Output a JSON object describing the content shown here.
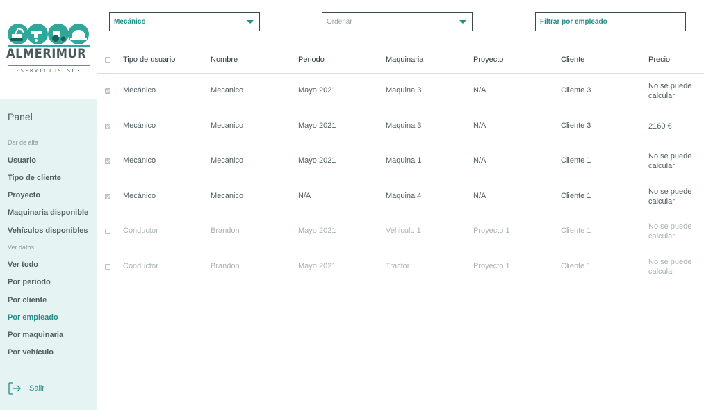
{
  "brand": {
    "name": "ALMERIMUR",
    "subtitle": "·SERVICIOS SL·"
  },
  "colors": {
    "accent": "#1f8f87",
    "sidebar_bg": "#e5f3f2",
    "logo_teal": "#2fa79a"
  },
  "sidebar": {
    "panel_title": "Panel",
    "sections": [
      {
        "label": "Dar de alta",
        "items": [
          "Usuario",
          "Tipo de cliente",
          "Proyecto",
          "Maquinaria disponible",
          "Vehículos disponibles"
        ]
      },
      {
        "label": "Ver datos",
        "items": [
          "Ver todo",
          "Por periodo",
          "Por cliente",
          "Por empleado",
          "Por maquinaria",
          "Por vehículo"
        ]
      }
    ],
    "active_item": "Por empleado",
    "logout": {
      "label": "Salir",
      "icon": "logout-icon"
    }
  },
  "filters": {
    "role_select": {
      "value": "Mecánico"
    },
    "order_select": {
      "placeholder": "Ordenar"
    },
    "employee_filter": {
      "value": "Filtrar por empleado"
    }
  },
  "table": {
    "headers": [
      "Tipo de usuario",
      "Nombre",
      "Periodo",
      "Maquinaria",
      "Proyecto",
      "Cliente",
      "Precio"
    ],
    "rows": [
      {
        "checked": true,
        "tipo": "Mecánico",
        "nombre": "Mecanico",
        "periodo": "Mayo 2021",
        "maquinaria": "Maquina 3",
        "proyecto": "N/A",
        "cliente": "Cliente 3",
        "precio": "No se puede calcular"
      },
      {
        "checked": true,
        "tipo": "Mecánico",
        "nombre": "Mecanico",
        "periodo": "Mayo 2021",
        "maquinaria": "Maquina 3",
        "proyecto": "N/A",
        "cliente": "Cliente 3",
        "precio": "2160 €"
      },
      {
        "checked": true,
        "tipo": "Mecánico",
        "nombre": "Mecanico",
        "periodo": "Mayo 2021",
        "maquinaria": "Maquina 1",
        "proyecto": "N/A",
        "cliente": "Cliente 1",
        "precio": "No se puede calcular"
      },
      {
        "checked": true,
        "tipo": "Mecánico",
        "nombre": "Mecanico",
        "periodo": "N/A",
        "maquinaria": "Maquina 4",
        "proyecto": "N/A",
        "cliente": "Cliente 1",
        "precio": "No se puede calcular"
      },
      {
        "checked": false,
        "tipo": "Conductor",
        "nombre": "Brandon",
        "periodo": "Mayo 2021",
        "maquinaria": "Vehiculo 1",
        "proyecto": "Proyecto 1",
        "cliente": "Cliente 1",
        "precio": "No se puede calcular"
      },
      {
        "checked": false,
        "tipo": "Conductor",
        "nombre": "Brandon",
        "periodo": "Mayo 2021",
        "maquinaria": "Tractor",
        "proyecto": "Proyecto 1",
        "cliente": "Cliente 1",
        "precio": "No se puede calcular"
      }
    ]
  }
}
